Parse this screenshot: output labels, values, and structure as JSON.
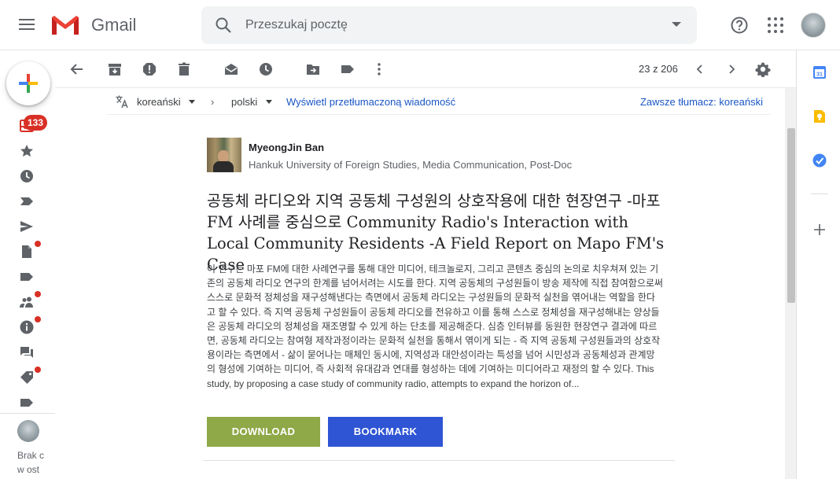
{
  "header": {
    "app_name": "Gmail",
    "search_placeholder": "Przeszukaj pocztę"
  },
  "rail": {
    "inbox_count": "133",
    "footer_text_1": "Brak c",
    "footer_text_2": "w ost"
  },
  "toolbar": {
    "page_count": "23 z 206"
  },
  "translation": {
    "source_lang": "koreański",
    "target_lang": "polski",
    "arrow": "›",
    "view_translated": "Wyświetl przetłumaczoną wiadomość",
    "always_translate": "Zawsze tłumacz: koreański"
  },
  "message": {
    "author_name": "MyeongJin Ban",
    "author_affiliation": "Hankuk University of Foreign Studies, Media Communication, Post-Doc",
    "title": "공동체 라디오와 지역 공동체 구성원의 상호작용에 대한 현장연구 -마포 FM 사례를 중심으로 Community Radio's Interaction with Local Community Residents -A Field Report on Mapo FM's Case",
    "abstract": "이 연구는 마포 FM에 대한 사례연구를 통해 대안 미디어, 테크놀로지, 그리고 콘텐츠 중심의 논의로 치우쳐져 있는 기존의 공동체 라디오 연구의 한계를 넘어서려는 시도를 한다. 지역 공동체의 구성원들이 방송 제작에 직접 참여함으로써 스스로 문화적 정체성을 재구성해낸다는 측면에서 공동체 라디오는 구성원들의 문화적 실천을 엮어내는 역할을 한다고 할 수 있다. 즉 지역 공동체 구성원들이 공동체 라디오를 전유하고 이를 통해 스스로 정체성을 재구성해내는 양상들은 공동체 라디오의 정체성을 재조명할 수 있게 하는 단초를 제공해준다. 심층 인터뷰를 동원한 현장연구 결과에 따르면, 공동체 라디오는 참여형 제작과정이라는 문화적 실천을 통해서 엮이게 되는 - 즉 지역 공동체 구성원들과의 상호작용이라는 측면에서 - 삶이 묻어나는 매체인 동시에, 지역성과 대안성이라는 특성을 넘어 시민성과 공동체성과 관계망의 형성에 기여하는 미디어, 즉 사회적 유대감과 연대를 형성하는 데에 기여하는 미디어라고 재정의 할 수 있다. This study, by proposing a case study of community radio, attempts to expand the horizon of...",
    "download_label": "DOWNLOAD",
    "bookmark_label": "BOOKMARK"
  },
  "colors": {
    "download": "#8fa848",
    "bookmark": "#2f54d4",
    "link": "#1a56c4",
    "badge": "#d93025"
  }
}
